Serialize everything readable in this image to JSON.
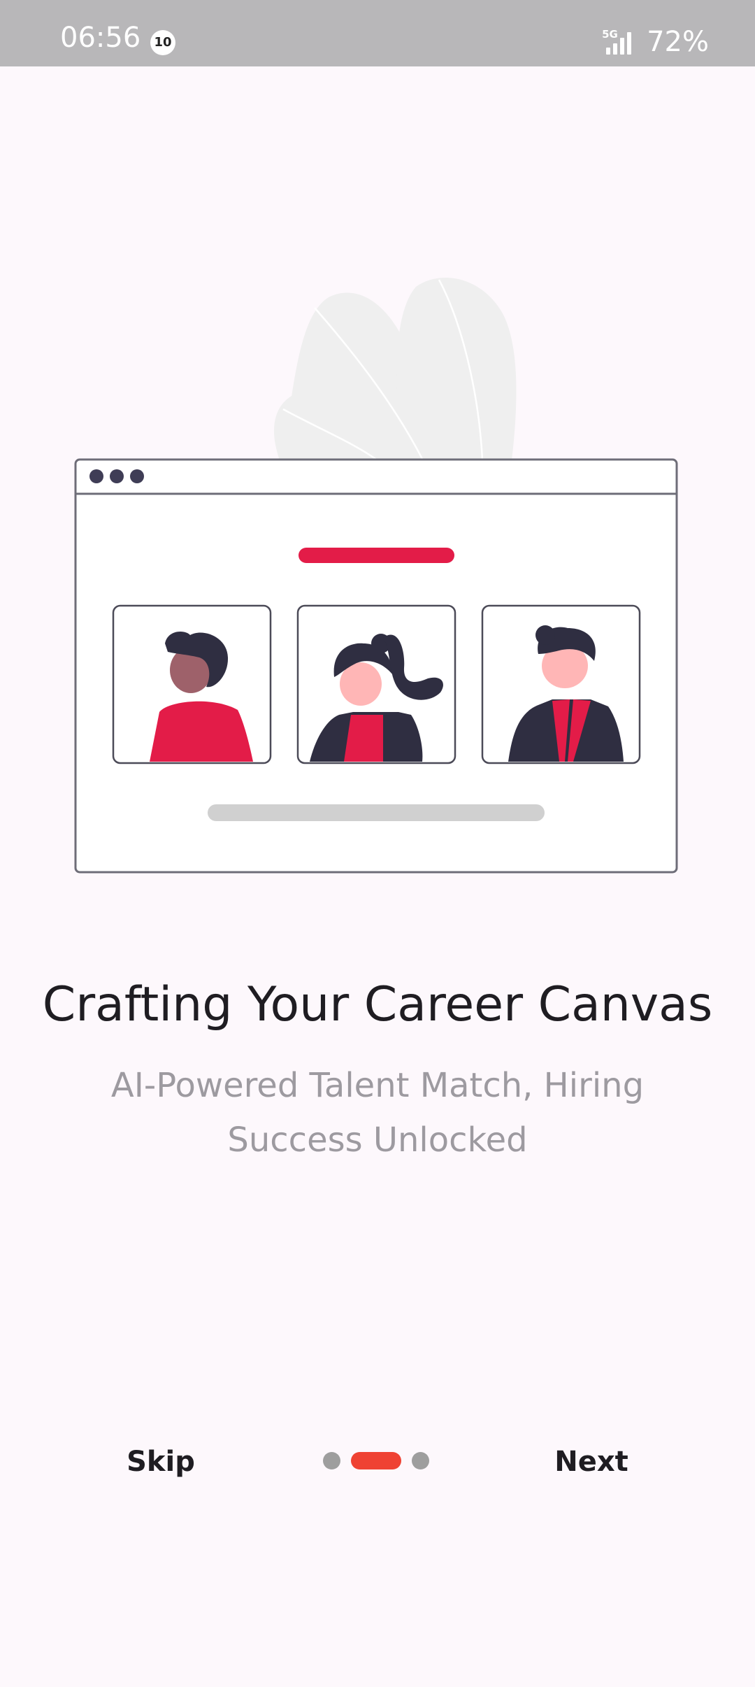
{
  "status_bar": {
    "time": "06:56",
    "notification_count": "10",
    "network": "5G",
    "battery": "72%"
  },
  "onboarding": {
    "title": "Crafting Your Career Canvas",
    "subtitle": "AI-Powered Talent Match, Hiring Success Unlocked",
    "skip_label": "Skip",
    "next_label": "Next",
    "page_total": 3,
    "page_current": 2
  },
  "colors": {
    "accent_red": "#e31c48",
    "indicator_active": "#ef4233",
    "indicator_inactive": "#9e9e9e",
    "dark_figure": "#2f2e41",
    "background": "#fdf8fc"
  },
  "icons": {
    "signal": "signal-bars-icon",
    "illustration": "candidate-profiles-illustration"
  }
}
